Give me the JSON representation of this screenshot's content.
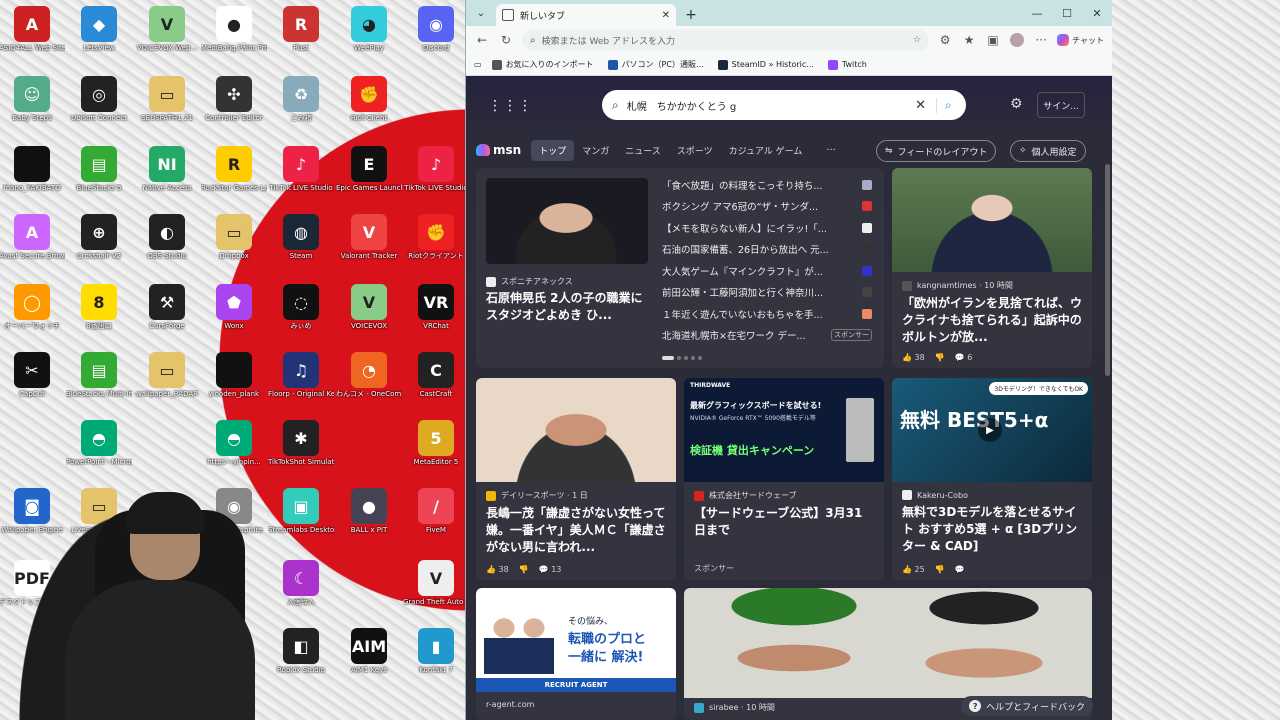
{
  "desktop": {
    "icons": [
      {
        "label": "ASIO4ALL Web Site",
        "color": "#c22",
        "glyph": "A"
      },
      {
        "label": "LetsView",
        "color": "#2a8ad8",
        "glyph": "◆"
      },
      {
        "label": "VOICEVOX.Web...",
        "color": "#8c8",
        "glyph": "V"
      },
      {
        "label": "MediBang Paint Pro",
        "color": "#fff",
        "glyph": "●"
      },
      {
        "label": "Rust",
        "color": "#c33",
        "glyph": "R"
      },
      {
        "label": "WeePlay",
        "color": "#3cd",
        "glyph": "◕"
      },
      {
        "label": "Discord",
        "color": "#5865f2",
        "glyph": "◉"
      },
      {
        "label": "Baby Steps",
        "color": "#5a8",
        "glyph": "☺"
      },
      {
        "label": "Ubisoft Connect",
        "color": "#222",
        "glyph": "◎"
      },
      {
        "label": "SEUSPATH1.21",
        "color": "#e5c36a",
        "glyph": "▭"
      },
      {
        "label": "Controller Editor",
        "color": "#333",
        "glyph": "✣"
      },
      {
        "label": "ごみ箱",
        "color": "#8ab",
        "glyph": "♻"
      },
      {
        "label": "Riot Client",
        "color": "#e22",
        "glyph": "✊"
      },
      {
        "label": "fnano_YAKIBATO",
        "color": "#111",
        "glyph": ""
      },
      {
        "label": "BlueStacks 5",
        "color": "#3a3",
        "glyph": "▤"
      },
      {
        "label": "Native Access",
        "color": "#2a6",
        "glyph": "NI"
      },
      {
        "label": "Rockstar Games Launcher",
        "color": "#fc0",
        "glyph": "R"
      },
      {
        "label": "TikTok LIVE Studio",
        "color": "#e24",
        "glyph": "♪"
      },
      {
        "label": "Epic Games Launcher",
        "color": "#111",
        "glyph": "E"
      },
      {
        "label": "TikTok LIVE Studio",
        "color": "#e24",
        "glyph": "♪"
      },
      {
        "label": "Avast Secure Browser",
        "color": "#c6f",
        "glyph": "A"
      },
      {
        "label": "Crosshair V2",
        "color": "#222",
        "glyph": "⊕"
      },
      {
        "label": "OBS Studio",
        "color": "#222",
        "glyph": "◐"
      },
      {
        "label": "Dropbox",
        "color": "#e5c36a",
        "glyph": "▭"
      },
      {
        "label": "Steam",
        "color": "#1b2838",
        "glyph": "◍"
      },
      {
        "label": "Valorant Tracker",
        "color": "#e44",
        "glyph": "V"
      },
      {
        "label": "Riotクライアント",
        "color": "#e22",
        "glyph": "✊"
      },
      {
        "label": "オーバーウォッチ",
        "color": "#f90",
        "glyph": "◯"
      },
      {
        "label": "8番出口",
        "color": "#fd0",
        "glyph": "8"
      },
      {
        "label": "CursForge",
        "color": "#222",
        "glyph": "⚒"
      },
      {
        "label": "Wonx",
        "color": "#a4e",
        "glyph": "⬟"
      },
      {
        "label": "みぃめ",
        "color": "#111",
        "glyph": "◌"
      },
      {
        "label": "VOICEVOX",
        "color": "#8c8",
        "glyph": "V"
      },
      {
        "label": "VRChat",
        "color": "#111",
        "glyph": "VR"
      },
      {
        "label": "CapCut",
        "color": "#111",
        "glyph": "✂"
      },
      {
        "label": "BlueStacks Multi-Instance",
        "color": "#3a3",
        "glyph": "▤"
      },
      {
        "label": "wallpaper_RADAR",
        "color": "#e5c36a",
        "glyph": "▭"
      },
      {
        "label": "wooden_plank",
        "color": "#111",
        "glyph": ""
      },
      {
        "label": "Floorp - Original Ke...",
        "color": "#237",
        "glyph": "♫"
      },
      {
        "label": "わんコメ - OneComme",
        "color": "#e62",
        "glyph": "◔"
      },
      {
        "label": "CastCraft",
        "color": "#222",
        "glyph": "C"
      },
      {
        "label": "PowerPoint - Microsoft 365",
        "color": "#0a7",
        "glyph": "◓"
      },
      {
        "label": "https---yinpin...",
        "color": "#0a7",
        "glyph": "◓"
      },
      {
        "label": "TikTokShot Simulator",
        "color": "#222",
        "glyph": "✱"
      },
      {
        "label": "MetaEditor 5",
        "color": "#da2",
        "glyph": "5"
      },
      {
        "label": "Wallpaper Engine",
        "color": "#26c",
        "glyph": "◙"
      },
      {
        "label": "LiveSplit_1.8.29",
        "color": "#e5c36a",
        "glyph": "▭"
      },
      {
        "label": "HD Live Capture",
        "color": "#888",
        "glyph": "◉"
      },
      {
        "label": "Streamlabs Desktop",
        "color": "#3cb",
        "glyph": "▣"
      },
      {
        "label": "BALL x PIT",
        "color": "#445",
        "glyph": "●"
      },
      {
        "label": "FiveM",
        "color": "#e45",
        "glyph": "/"
      },
      {
        "label": "デスクトップ 出力する 試写71.ps",
        "color": "#fff",
        "glyph": "PDF"
      },
      {
        "label": "入眠導入",
        "color": "#a3c",
        "glyph": "☾"
      },
      {
        "label": "Grand Theft Auto V",
        "color": "#eee",
        "glyph": "V"
      },
      {
        "label": "Roblox Studio",
        "color": "#222",
        "glyph": "◧"
      },
      {
        "label": "AIM1 Keys",
        "color": "#111",
        "glyph": "AIM"
      },
      {
        "label": "Kontakt 7",
        "color": "#29c",
        "glyph": "▮"
      }
    ]
  },
  "browser": {
    "tab_title": "新しいタブ",
    "tab_close": "✕",
    "new_tab": "+",
    "window_controls": [
      "—",
      "☐",
      "✕"
    ],
    "address_placeholder": "検索または Web アドレスを入力",
    "chat_label": "チャット",
    "favorites": [
      {
        "label": "お気に入りのインポート",
        "color": "#555"
      },
      {
        "label": "パソコン（PC）通販...",
        "color": "#2255aa"
      },
      {
        "label": "SteamID » Historic...",
        "color": "#1b2838"
      },
      {
        "label": "Twitch",
        "color": "#9146ff"
      }
    ]
  },
  "ntp": {
    "search_text": "札幌　ちかかかくとう g",
    "signin_label": "サイン...",
    "msn_label": "msn",
    "nav_tabs": [
      "トップ",
      "マンガ",
      "ニュース",
      "スポーツ",
      "カジュアル ゲーム"
    ],
    "nav_more": "···",
    "feed_layout_label": "フィードのレイアウト",
    "personalize_label": "個人用設定",
    "hero": {
      "source": "スポニチアネックス",
      "title": "石原伸晃氏 2人の子の職業にスタジオどよめき ひ..."
    },
    "headlines": [
      {
        "text": "「食べ放題」の料理をこっそり持ち...",
        "color": "#aac"
      },
      {
        "text": "ボクシング アマ6冠の“ザ・サンダ...",
        "color": "#d33"
      },
      {
        "text": "【メモを取らない新人】にイラッ!「...",
        "color": "#eee"
      },
      {
        "text": "石油の国家備蓄、26日から放出へ 元...",
        "color": "#333"
      },
      {
        "text": "大人気ゲーム『マインクラフト』が...",
        "color": "#33c"
      },
      {
        "text": "前田公輝・工藤阿須加と行く神奈川...",
        "color": "#444"
      },
      {
        "text": "１年近く遊んでいないおもちゃを手...",
        "color": "#e86"
      },
      {
        "text": "北海道札幌市×在宅ワーク デー...",
        "color": ""
      }
    ],
    "sponsored_label": "スポンサー",
    "card_right_top": {
      "source": "kangnamtimes · 10 時間",
      "title": "「欧州がイランを見捨てれば、ウクライナも捨てられる」起訴中のボルトンが放...",
      "likes": "38",
      "comments": "6"
    },
    "card_mid_1": {
      "source": "デイリースポーツ · 1 日",
      "title": "長嶋一茂「謙虚さがない女性って嫌。一番イヤ」美人ＭＣ「謙虚さがない男に言われ...",
      "likes": "38",
      "comments": "13"
    },
    "card_mid_2": {
      "source": "株式会社サードウェーブ",
      "title": "【サードウェーブ公式】3月31日まで",
      "sponsor": "スポンサー",
      "ad_brand": "THIRDWAVE",
      "ad_line1": "最新グラフィックスボードを試せる!",
      "ad_line2": "NVIDIA® GeForce RTX™ 5090搭載モデル等",
      "ad_line3": "検証機 貸出キャンペーン"
    },
    "card_mid_3": {
      "source": "Kakeru-Cobo",
      "title": "無料で3Dモデルを落とせるサイト おすすめ5選 + α [3Dプリンター & CAD]",
      "likes": "25",
      "ad_big": "無料 BEST5+α",
      "ad_bubble": "3Dモデリング！できなくてもOK"
    },
    "card_bottom_1": {
      "source": "r-agent.com",
      "ad_line1": "その悩み、",
      "ad_line2": "転職のプロと",
      "ad_line3": "一緒に 解決!",
      "ad_brand": "RECRUIT AGENT"
    },
    "card_bottom_2": {
      "source": "sirabee · 10 時間"
    },
    "help_label": "ヘルプとフィードバック"
  }
}
